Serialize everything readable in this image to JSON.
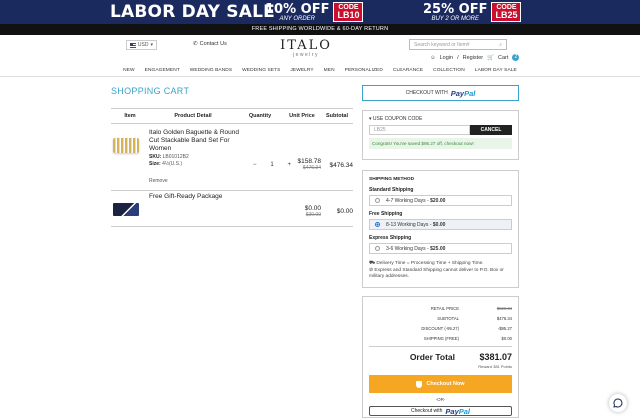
{
  "banner": {
    "sale_title": "LABOR DAY SALE",
    "offer1": {
      "pct": "10% OFF",
      "sub": "ANY ORDER",
      "code_label": "CODE",
      "code": "LB10"
    },
    "offer2": {
      "pct": "25% OFF",
      "sub": "BUY 2 OR MORE",
      "code_label": "CODE",
      "code": "LB25"
    }
  },
  "ship_bar": "FREE SHIPPING WORLDWIDE & 60-DAY RETURN",
  "header": {
    "currency": "USD",
    "contact": "Contact Us",
    "logo": "ITALO",
    "logo_sub": "jewelry",
    "search_placeholder": "Search keyword or Item#",
    "login": "Login",
    "register": "Register",
    "cart": "Cart",
    "cart_count": "2"
  },
  "nav": [
    "NEW",
    "ENGAGEMENT",
    "WEDDING BANDS",
    "WEDDING SETS",
    "JEWELRY",
    "MEN",
    "PERSONALIZED",
    "CLEARANCE",
    "COLLECTION",
    "LABOR DAY SALE"
  ],
  "cart": {
    "title": "SHOPPING CART",
    "headers": {
      "item": "Item",
      "detail": "Product Detail",
      "qty": "Quantity",
      "price": "Unit Price",
      "subtotal": "Subtotal"
    },
    "items": [
      {
        "name": "Italo Golden Baguette & Round Cut Stackable Band Set For Women",
        "sku_label": "SKU:",
        "sku": "LB01012B2",
        "size_label": "Size:",
        "size": "4½(U.S.)",
        "qty": "1",
        "price": "$158.78",
        "old_price": "$476.34",
        "subtotal": "$476.34",
        "remove": "Remove"
      },
      {
        "name": "Free Gift-Ready Package",
        "price": "$0.00",
        "old_price": "$30.00",
        "subtotal": "$0.00"
      }
    ]
  },
  "paypal_checkout": {
    "label": "CHECKOUT WITH",
    "brand_a": "Pay",
    "brand_b": "Pal"
  },
  "coupon": {
    "label": "USE COUPON CODE",
    "value": "LB25",
    "cancel": "CANCEL",
    "message": "Congrats! You've saved $95.27 off, checkout now!"
  },
  "shipping": {
    "heading": "SHIPPING METHOD",
    "groups": [
      {
        "name": "Standard Shipping",
        "days": "4-7 Working Days",
        "price": "$20.00",
        "selected": false
      },
      {
        "name": "Free Shipping",
        "days": "8-13 Working Days",
        "price": "$0.00",
        "selected": true
      },
      {
        "name": "Express Shipping",
        "days": "3-6 Working Days",
        "price": "$25.00",
        "selected": false
      }
    ],
    "note1": "Delivery Time = Processing Time + Shipping Time.",
    "note2": "Express and Standard Shipping cannot deliver to P.O. Box or military addresses."
  },
  "summary": {
    "rows": [
      {
        "k": "RETAIL PRICE",
        "v": "$526.34",
        "strike": true
      },
      {
        "k": "SUBTOTAL",
        "v": "$476.34",
        "strike": false
      },
      {
        "k": "DISCOUNT (-95.27)",
        "v": "-$95.27",
        "strike": false
      },
      {
        "k": "SHIPPING (FREE)",
        "v": "$0.00",
        "strike": false
      }
    ],
    "total_label": "Order Total",
    "total": "$381.07",
    "reward": "Reward 381 Points",
    "checkout": "Checkout Now",
    "or": "-OR-",
    "paypal2": "Checkout with"
  },
  "colors": {
    "accent": "#3aa3c9",
    "banner": "#1b2a5e",
    "code": "#c8102e",
    "checkout": "#f5a623"
  }
}
